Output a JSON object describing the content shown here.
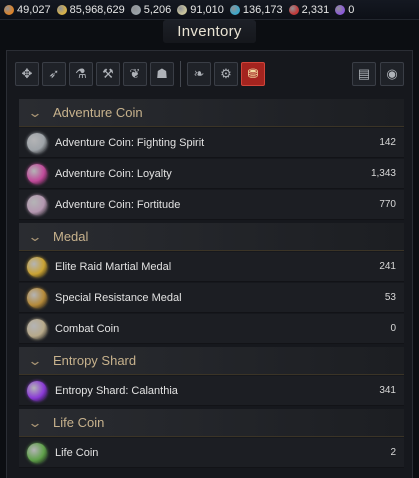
{
  "currency": [
    {
      "icon": "shield-currency-icon",
      "value": "49,027",
      "color": "#d9822b"
    },
    {
      "icon": "gold-coin-icon",
      "value": "85,968,629",
      "color": "#d7b14a"
    },
    {
      "icon": "silver-coin-icon",
      "value": "5,206",
      "color": "#9aa2a8"
    },
    {
      "icon": "gem-coin-icon",
      "value": "91,010",
      "color": "#c8c39c"
    },
    {
      "icon": "blue-crystal-icon",
      "value": "136,173",
      "color": "#3fa7c9"
    },
    {
      "icon": "red-gem-icon",
      "value": "2,331",
      "color": "#c23a3a"
    },
    {
      "icon": "purple-orb-icon",
      "value": "0",
      "color": "#8b5bd6"
    }
  ],
  "window": {
    "title": "Inventory"
  },
  "tabs": [
    {
      "name": "tab-all",
      "icon": "grid-icon",
      "glyph": "✥"
    },
    {
      "name": "tab-equipment",
      "icon": "bow-icon",
      "glyph": "➶"
    },
    {
      "name": "tab-consumable",
      "icon": "potion-icon",
      "glyph": "⚗"
    },
    {
      "name": "tab-tools",
      "icon": "anvil-icon",
      "glyph": "⚒"
    },
    {
      "name": "tab-materials",
      "icon": "herb-icon",
      "glyph": "❦"
    },
    {
      "name": "tab-bags",
      "icon": "pouch-icon",
      "glyph": "☗"
    },
    {
      "name": "tab-crafting",
      "icon": "leaf-icon",
      "glyph": "❧"
    },
    {
      "name": "tab-special",
      "icon": "gear-icon",
      "glyph": "⚙"
    },
    {
      "name": "tab-currency",
      "icon": "coins-icon",
      "glyph": "⛃"
    }
  ],
  "tool_buttons": [
    {
      "name": "sort-button",
      "icon": "book-icon",
      "glyph": "▤"
    },
    {
      "name": "settings-button",
      "icon": "eye-gear-icon",
      "glyph": "◉"
    }
  ],
  "sections": [
    {
      "title": "Adventure Coin",
      "items": [
        {
          "label": "Adventure Coin: Fighting Spirit",
          "count": "142",
          "icon": "fighting-spirit-coin-icon",
          "color": "#9ea3a8"
        },
        {
          "label": "Adventure Coin: Loyalty",
          "count": "1,343",
          "icon": "loyalty-coin-icon",
          "color": "#c04a9a"
        },
        {
          "label": "Adventure Coin: Fortitude",
          "count": "770",
          "icon": "fortitude-coin-icon",
          "color": "#b497b0"
        }
      ]
    },
    {
      "title": "Medal",
      "items": [
        {
          "label": "Elite Raid Martial Medal",
          "count": "241",
          "icon": "martial-medal-icon",
          "color": "#c9a233"
        },
        {
          "label": "Special Resistance Medal",
          "count": "53",
          "icon": "resistance-medal-icon",
          "color": "#b58a3a"
        },
        {
          "label": "Combat Coin",
          "count": "0",
          "icon": "combat-coin-icon",
          "color": "#b7a98a"
        }
      ]
    },
    {
      "title": "Entropy Shard",
      "items": [
        {
          "label": "Entropy Shard: Calanthia",
          "count": "341",
          "icon": "entropy-shard-icon",
          "color": "#8a3ad6"
        }
      ]
    },
    {
      "title": "Life Coin",
      "items": [
        {
          "label": "Life Coin",
          "count": "2",
          "icon": "life-coin-icon",
          "color": "#5fa04a"
        }
      ]
    }
  ]
}
